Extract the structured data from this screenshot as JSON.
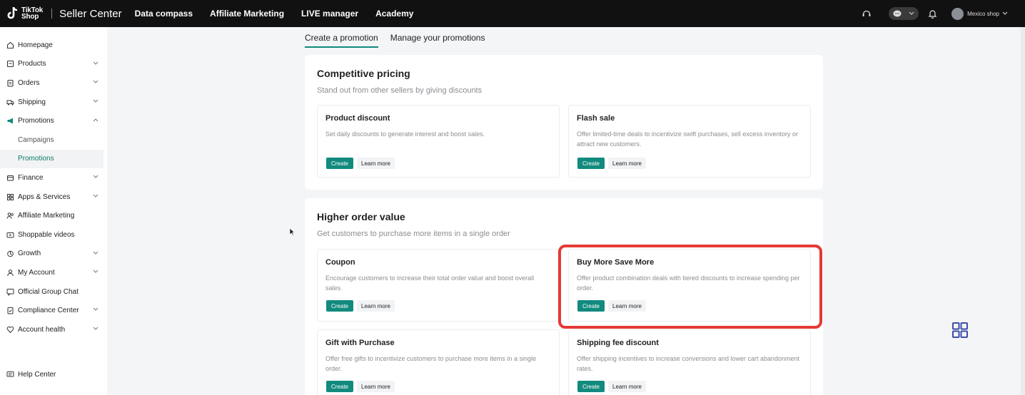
{
  "topbar": {
    "logo_line1": "TikTok",
    "logo_line2": "Shop",
    "brand": "Seller Center",
    "nav": [
      "Data compass",
      "Affiliate Marketing",
      "LIVE manager",
      "Academy"
    ],
    "shop_name": "Mexico shop"
  },
  "sidebar": {
    "items": [
      {
        "label": "Homepage",
        "icon": "home-icon"
      },
      {
        "label": "Products",
        "icon": "box-icon"
      },
      {
        "label": "Orders",
        "icon": "clipboard-icon"
      },
      {
        "label": "Shipping",
        "icon": "truck-icon"
      },
      {
        "label": "Promotions",
        "icon": "megaphone-icon"
      },
      {
        "label": "Campaigns",
        "icon": ""
      },
      {
        "label": "Promotions",
        "icon": ""
      },
      {
        "label": "Finance",
        "icon": "wallet-icon"
      },
      {
        "label": "Apps & Services",
        "icon": "apps-icon"
      },
      {
        "label": "Affiliate Marketing",
        "icon": "people-icon"
      },
      {
        "label": "Shoppable videos",
        "icon": "video-icon"
      },
      {
        "label": "Growth",
        "icon": "growth-icon"
      },
      {
        "label": "My Account",
        "icon": "user-icon"
      },
      {
        "label": "Official Group Chat",
        "icon": "chat-icon"
      },
      {
        "label": "Compliance Center",
        "icon": "compliance-icon"
      },
      {
        "label": "Account health",
        "icon": "health-icon"
      }
    ],
    "help": "Help Center"
  },
  "tabs": [
    "Create a promotion",
    "Manage your promotions"
  ],
  "sections": [
    {
      "title": "Competitive pricing",
      "subtitle": "Stand out from other sellers by giving discounts",
      "cards": [
        {
          "title": "Product discount",
          "desc": "Set daily discounts to generate interest and boost sales."
        },
        {
          "title": "Flash sale",
          "desc": "Offer limited-time deals to incentivize swift purchases, sell excess inventory or attract new customers."
        }
      ]
    },
    {
      "title": "Higher order value",
      "subtitle": "Get customers to purchase more items in a single order",
      "cards": [
        {
          "title": "Coupon",
          "desc": "Encourage customers to increase their total order value and boost overall sales."
        },
        {
          "title": "Buy More Save More",
          "desc": "Offer product combination deals with tiered discounts to increase spending per order."
        },
        {
          "title": "Gift with Purchase",
          "desc": "Offer free gifts to incentivize customers to purchase more items in a single order."
        },
        {
          "title": "Shipping fee discount",
          "desc": "Offer shipping incentives to increase conversions and lower cart abandonment rates."
        }
      ]
    }
  ],
  "buttons": {
    "create": "Create",
    "learn_more": "Learn more"
  },
  "colors": {
    "accent": "#128a7e",
    "highlight": "#e53935",
    "topbar": "#111111"
  }
}
